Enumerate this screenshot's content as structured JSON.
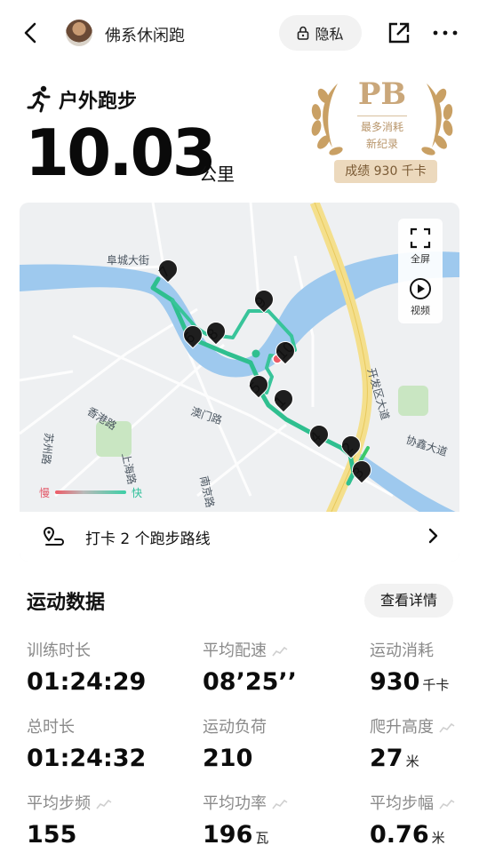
{
  "header": {
    "username": "佛系休闲跑",
    "privacy_label": "隐私"
  },
  "workout": {
    "sport_name": "户外跑步",
    "distance": "10.03",
    "distance_unit": "公里"
  },
  "pb_badge": {
    "title": "PB",
    "line1": "最多消耗",
    "line2": "新纪录",
    "result": "成绩 930 千卡",
    "color": "#caa77a"
  },
  "map": {
    "street_labels": [
      "阜城大街",
      "香港路",
      "澳门路",
      "上海路",
      "南京路",
      "苏州路",
      "开发区大道",
      "协鑫大道"
    ],
    "markers": [
      "1",
      "2",
      "3",
      "4",
      "5",
      "6",
      "7",
      "8",
      "9",
      "10"
    ],
    "controls": {
      "fullscreen_label": "全屏",
      "video_label": "视频"
    },
    "legend": {
      "slow": "慢",
      "fast": "快"
    },
    "checkin_text": "打卡 2 个跑步路线",
    "route_color": "#2fbf8f",
    "water_color": "#9ec9ee"
  },
  "stats": {
    "section_title": "运动数据",
    "detail_button": "查看详情",
    "items": [
      {
        "label": "训练时长",
        "value": "01:24:29",
        "unit": ""
      },
      {
        "label": "平均配速",
        "value": "08’25’’",
        "unit": ""
      },
      {
        "label": "运动消耗",
        "value": "930",
        "unit": "千卡"
      },
      {
        "label": "总时长",
        "value": "01:24:32",
        "unit": ""
      },
      {
        "label": "运动负荷",
        "value": "210",
        "unit": ""
      },
      {
        "label": "爬升高度",
        "value": "27",
        "unit": "米"
      },
      {
        "label": "平均步频",
        "value": "155",
        "unit": ""
      },
      {
        "label": "平均功率",
        "value": "196",
        "unit": "瓦"
      },
      {
        "label": "平均步幅",
        "value": "0.76",
        "unit": "米"
      }
    ]
  }
}
